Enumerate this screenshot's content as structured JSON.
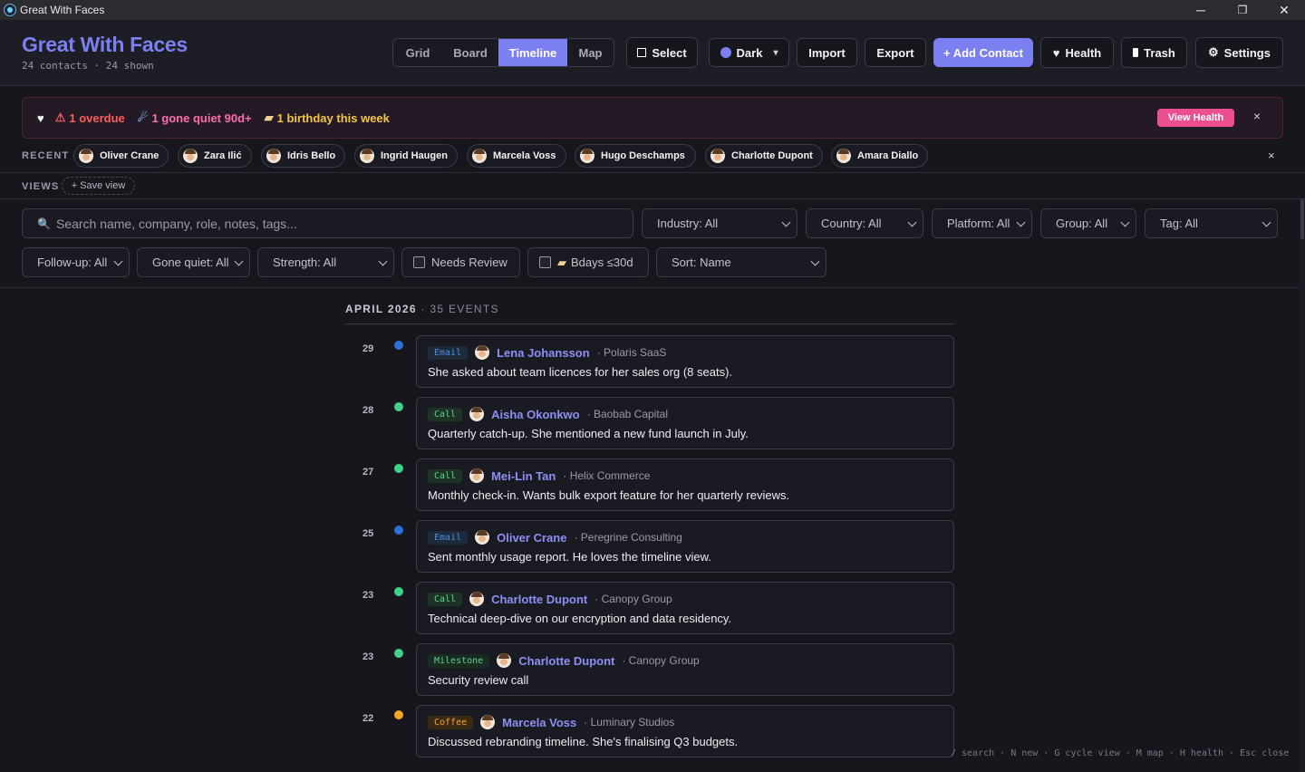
{
  "window": {
    "title": "Great With Faces",
    "min": "─",
    "restore": "❐",
    "close": "✕"
  },
  "header": {
    "title": "Great With Faces",
    "subtitle": "24 contacts · 24 shown",
    "views": [
      "Grid",
      "Board",
      "Timeline",
      "Map"
    ],
    "active_view": "Timeline",
    "buttons": {
      "select": "Select",
      "theme": "Dark",
      "theme_arrow": "▾",
      "import": "Import",
      "export": "Export",
      "add_contact": "+ Add Contact",
      "health": "Health",
      "trash": "Trash",
      "settings": "Settings"
    }
  },
  "alert": {
    "heart": "♥",
    "overdue": "1 overdue",
    "overdue_icon": "⚠",
    "quiet": "1 gone quiet 90d+",
    "quiet_icon": "☄",
    "birthday": "1 birthday this week",
    "birthday_icon": "▰",
    "view_health": "View Health",
    "close": "×"
  },
  "recent": {
    "label": "RECENT",
    "items": [
      "Oliver Crane",
      "Zara Ilić",
      "Idris Bello",
      "Ingrid Haugen",
      "Marcela Voss",
      "Hugo Deschamps",
      "Charlotte Dupont",
      "Amara Diallo"
    ],
    "close": "×"
  },
  "views_bar": {
    "label": "VIEWS",
    "save": "+ Save view"
  },
  "filters": {
    "search_placeholder": "Search name, company, role, notes, tags...",
    "search_icon": "🔍",
    "industry": "Industry: All",
    "country": "Country: All",
    "platform": "Platform: All",
    "group": "Group: All",
    "tag": "Tag: All",
    "followup": "Follow-up: All",
    "gone_quiet": "Gone quiet: All",
    "strength": "Strength: All",
    "needs_review": "Needs Review",
    "bdays": "Bdays ≤30d",
    "bdays_icon": "▰",
    "sort": "Sort: Name"
  },
  "timeline": {
    "month": "APRIL 2026",
    "count": "· 35 EVENTS",
    "events": [
      {
        "day": "29",
        "type": "Email",
        "name": "Lena Johansson",
        "company": "· Polaris SaaS",
        "note": "She asked about team licences for her sales org (8 seats).",
        "color": "#2b6fd6"
      },
      {
        "day": "28",
        "type": "Call",
        "name": "Aisha Okonkwo",
        "company": "· Baobab Capital",
        "note": "Quarterly catch-up. She mentioned a new fund launch in July.",
        "color": "#3fd08a"
      },
      {
        "day": "27",
        "type": "Call",
        "name": "Mei-Lin Tan",
        "company": "· Helix Commerce",
        "note": "Monthly check-in. Wants bulk export feature for her quarterly reviews.",
        "color": "#3fd08a"
      },
      {
        "day": "25",
        "type": "Email",
        "name": "Oliver Crane",
        "company": "· Peregrine Consulting",
        "note": "Sent monthly usage report. He loves the timeline view.",
        "color": "#2b6fd6"
      },
      {
        "day": "23",
        "type": "Call",
        "name": "Charlotte Dupont",
        "company": "· Canopy Group",
        "note": "Technical deep-dive on our encryption and data residency.",
        "color": "#3fd08a"
      },
      {
        "day": "23",
        "type": "Milestone",
        "name": "Charlotte Dupont",
        "company": "· Canopy Group",
        "note": "Security review call",
        "color": "#3fd08a"
      },
      {
        "day": "22",
        "type": "Coffee",
        "name": "Marcela Voss",
        "company": "· Luminary Studios",
        "note": "Discussed rebranding timeline. She's finalising Q3 budgets.",
        "color": "#f5a623"
      }
    ]
  },
  "shortcuts": "/ search · N new · G cycle view · M map · H health · Esc close"
}
